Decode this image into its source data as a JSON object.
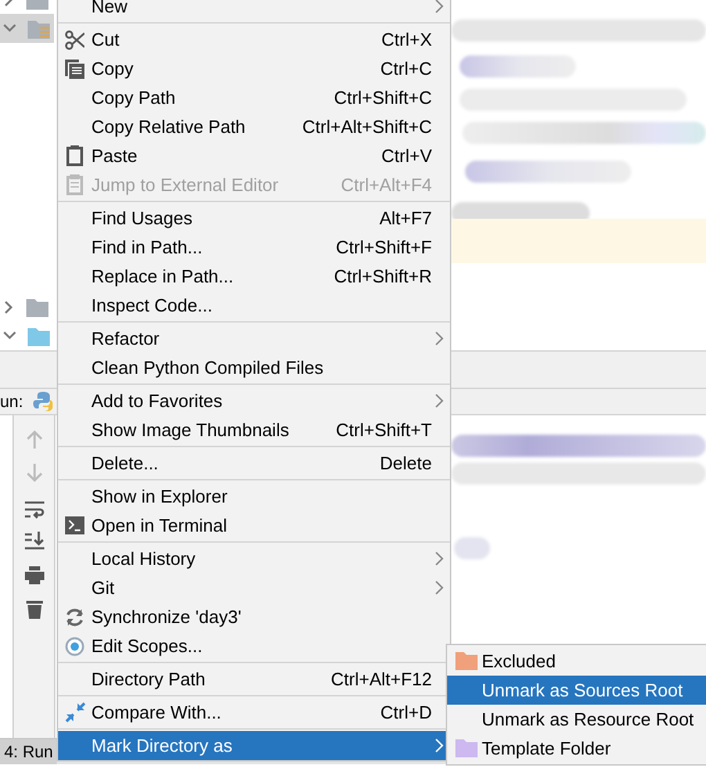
{
  "project_tree": {
    "rows": [
      {
        "expanded": false,
        "selected": false
      },
      {
        "expanded": true,
        "selected": true
      }
    ],
    "lower_rows": [
      {
        "expanded": false,
        "selected": false
      },
      {
        "expanded": true,
        "selected": false
      }
    ]
  },
  "run_panel": {
    "title": "un:"
  },
  "bottom_bar": {
    "tab": "4: Run"
  },
  "context_menu": {
    "items": [
      {
        "kind": "item",
        "label": "New",
        "submenu": true,
        "disabled": false,
        "selected": false
      },
      {
        "kind": "separator"
      },
      {
        "kind": "item",
        "label": "Cut",
        "shortcut": "Ctrl+X",
        "disabled": false,
        "selected": false
      },
      {
        "kind": "item",
        "label": "Copy",
        "shortcut": "Ctrl+C",
        "disabled": false,
        "selected": false
      },
      {
        "kind": "item",
        "label": "Copy Path",
        "shortcut": "Ctrl+Shift+C",
        "disabled": false,
        "selected": false
      },
      {
        "kind": "item",
        "label": "Copy Relative Path",
        "shortcut": "Ctrl+Alt+Shift+C",
        "disabled": false,
        "selected": false
      },
      {
        "kind": "item",
        "label": "Paste",
        "shortcut": "Ctrl+V",
        "disabled": false,
        "selected": false
      },
      {
        "kind": "item",
        "label": "Jump to External Editor",
        "shortcut": "Ctrl+Alt+F4",
        "disabled": true,
        "selected": false
      },
      {
        "kind": "separator"
      },
      {
        "kind": "item",
        "label": "Find Usages",
        "shortcut": "Alt+F7",
        "disabled": false,
        "selected": false
      },
      {
        "kind": "item",
        "label": "Find in Path...",
        "shortcut": "Ctrl+Shift+F",
        "disabled": false,
        "selected": false
      },
      {
        "kind": "item",
        "label": "Replace in Path...",
        "shortcut": "Ctrl+Shift+R",
        "disabled": false,
        "selected": false
      },
      {
        "kind": "item",
        "label": "Inspect Code...",
        "disabled": false,
        "selected": false
      },
      {
        "kind": "separator"
      },
      {
        "kind": "item",
        "label": "Refactor",
        "submenu": true,
        "disabled": false,
        "selected": false
      },
      {
        "kind": "item",
        "label": "Clean Python Compiled Files",
        "disabled": false,
        "selected": false
      },
      {
        "kind": "separator"
      },
      {
        "kind": "item",
        "label": "Add to Favorites",
        "submenu": true,
        "disabled": false,
        "selected": false
      },
      {
        "kind": "item",
        "label": "Show Image Thumbnails",
        "shortcut": "Ctrl+Shift+T",
        "disabled": false,
        "selected": false
      },
      {
        "kind": "separator"
      },
      {
        "kind": "item",
        "label": "Delete...",
        "shortcut": "Delete",
        "disabled": false,
        "selected": false
      },
      {
        "kind": "separator"
      },
      {
        "kind": "item",
        "label": "Show in Explorer",
        "disabled": false,
        "selected": false
      },
      {
        "kind": "item",
        "label": "Open in Terminal",
        "disabled": false,
        "selected": false
      },
      {
        "kind": "separator"
      },
      {
        "kind": "item",
        "label": "Local History",
        "submenu": true,
        "disabled": false,
        "selected": false
      },
      {
        "kind": "item",
        "label": "Git",
        "submenu": true,
        "disabled": false,
        "selected": false
      },
      {
        "kind": "item",
        "label": "Synchronize 'day3'",
        "disabled": false,
        "selected": false
      },
      {
        "kind": "item",
        "label": "Edit Scopes...",
        "disabled": false,
        "selected": false
      },
      {
        "kind": "separator"
      },
      {
        "kind": "item",
        "label": "Directory Path",
        "shortcut": "Ctrl+Alt+F12",
        "disabled": false,
        "selected": false
      },
      {
        "kind": "separator"
      },
      {
        "kind": "item",
        "label": "Compare With...",
        "shortcut": "Ctrl+D",
        "disabled": false,
        "selected": false
      },
      {
        "kind": "separator"
      },
      {
        "kind": "item",
        "label": "Mark Directory as",
        "submenu": true,
        "disabled": false,
        "selected": true
      }
    ]
  },
  "submenu": {
    "items": [
      {
        "label": "Excluded",
        "color": "#f0a07a",
        "selected": false
      },
      {
        "label": "Unmark as Sources Root",
        "selected": true
      },
      {
        "label": "Unmark as Resource Root",
        "selected": false
      },
      {
        "label": "Template Folder",
        "color": "#cdb8f0",
        "selected": false
      }
    ]
  }
}
